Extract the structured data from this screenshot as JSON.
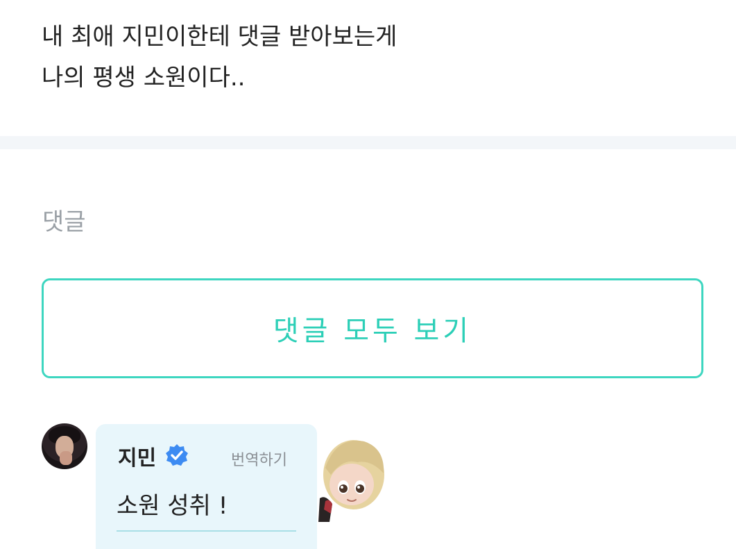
{
  "post": {
    "lines": [
      "내 최애 지민이한테 댓글 받아보는게",
      "나의 평생 소원이다.."
    ]
  },
  "comments_section": {
    "heading": "댓글",
    "view_all_label": "댓글 모두 보기"
  },
  "comment": {
    "author": "지민",
    "translate_label": "번역하기",
    "text": "소원 성취 !",
    "verified_icon": "verified-check-icon",
    "avatar_icon": "artist-avatar",
    "sticker_icon": "character-sticker"
  },
  "colors": {
    "accent": "#2ccfb7",
    "bubble": "#e8f6fb",
    "verified": "#3d8bf2"
  }
}
